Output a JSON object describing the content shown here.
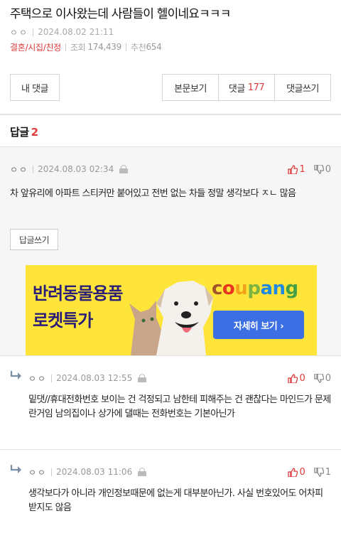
{
  "post": {
    "title": "주택으로 이사왔는데 사람들이 헬이네요ㅋㅋㅋ",
    "author": "ㅇㅇ",
    "date": "2024.08.02 21:11",
    "category": "결혼/시집/친정",
    "views_label": "조회",
    "views": "174,439",
    "recommend_label": "추천",
    "recommend": "654"
  },
  "buttons": {
    "my_comments": "내 댓글",
    "view_post": "본문보기",
    "comments_label": "댓글",
    "comments_count": "177",
    "write_comment": "댓글쓰기"
  },
  "replies": {
    "heading": "답글",
    "count": "2"
  },
  "comments": [
    {
      "nick": "ㅇㅇ",
      "date": "2024.08.03 02:34",
      "up": "1",
      "down": "0",
      "text": "차 앞유리에 아파트 스티커만 붙어있고 전번 없는 차들 정말 생각보다 ㅈㄴ 많음",
      "reply_button": "답글쓰기"
    },
    {
      "nick": "ㅇㅇ",
      "date": "2024.08.03 12:55",
      "up": "0",
      "down": "0",
      "text": "밑댓//휴대전화번호 보이는 건 걱정되고 남한테 피해주는 건 괜찮다는 마인드가 문제란거임 남의집이나 상가에 댈때는 전화번호는 기본아닌가"
    },
    {
      "nick": "ㅇㅇ",
      "date": "2024.08.03 11:06",
      "up": "0",
      "down": "1",
      "text": "생각보다가 아니라 개인정보때문에 없는게 대부분아닌가. 사실 번호있어도 어차피 받지도 않음"
    }
  ],
  "ad": {
    "line1": "반려동물용품",
    "line2": "로켓특가",
    "brand": "coupang",
    "cta": "자세히 보기 ›"
  },
  "colors": {
    "accent_red": "#e03a3a",
    "ad_bg": "#ffe53a",
    "ad_text": "#2b1e78",
    "ad_button": "#3b6fe3"
  }
}
